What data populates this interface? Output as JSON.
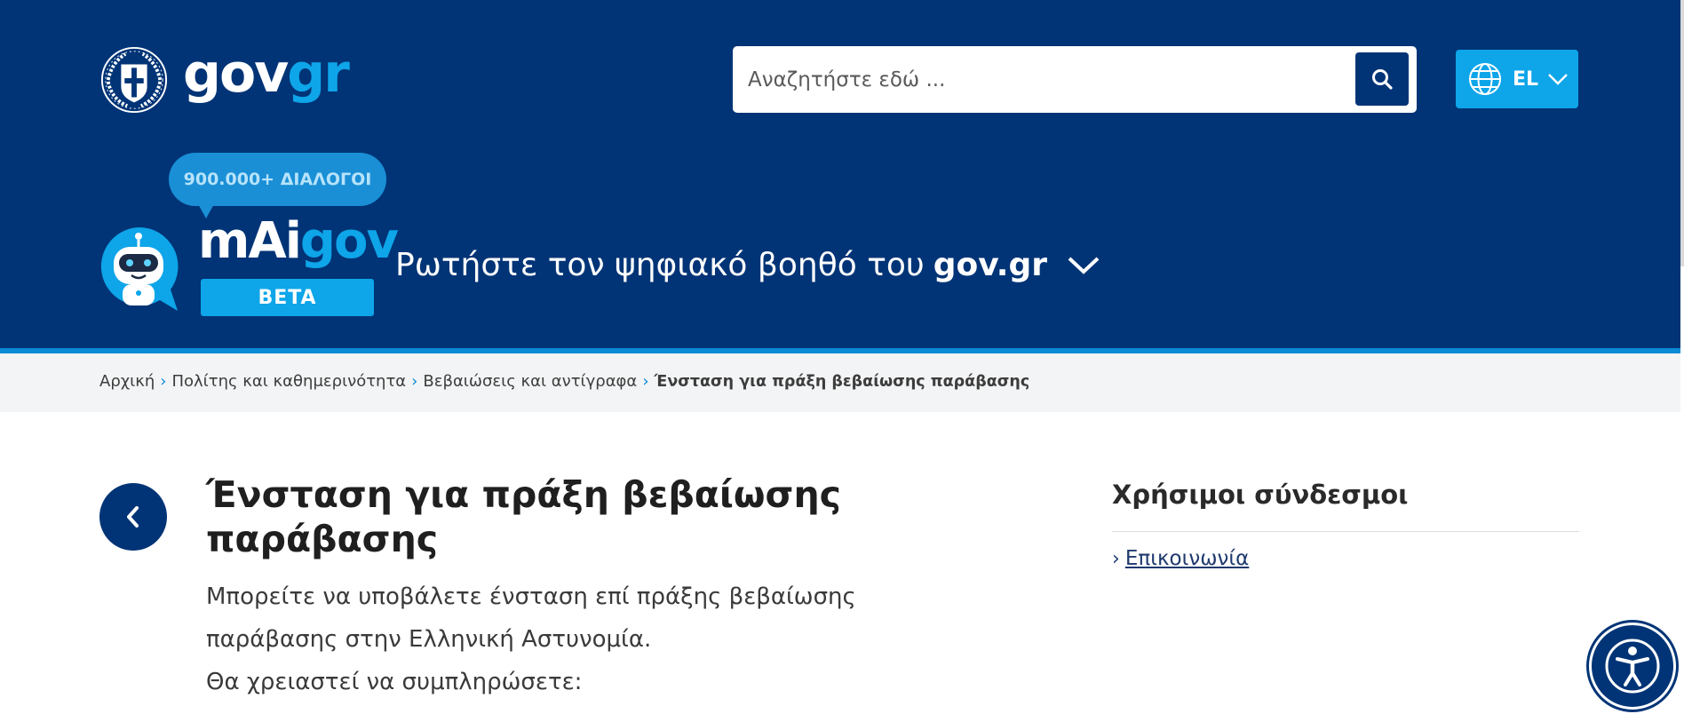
{
  "header": {
    "logo": {
      "part1": "gov",
      "part2": "gr"
    },
    "search": {
      "placeholder": "Αναζητήστε εδώ ..."
    },
    "language": {
      "label": "EL"
    }
  },
  "maigov": {
    "badge": "900.000+ ΔΙΑΛΟΓΟΙ",
    "title_part1": "mAi",
    "title_part2": "gov",
    "beta": "BETA",
    "assistant_text": "Ρωτήστε τον ψηφιακό βοηθό του",
    "assistant_bold": "gov.gr"
  },
  "breadcrumb": {
    "items": [
      "Αρχική",
      "Πολίτης και καθημερινότητα",
      "Βεβαιώσεις και αντίγραφα"
    ],
    "current": "Ένσταση για πράξη βεβαίωσης παράβασης"
  },
  "main": {
    "title": "Ένσταση για πράξη βεβαίωσης παράβασης",
    "description": "Μπορείτε να υποβάλετε ένσταση επί πράξης βεβαίωσης παράβασης στην Ελληνική Αστυνομία.",
    "fill_in": "Θα χρειαστεί να συμπληρώσετε:"
  },
  "sidebar": {
    "title": "Χρήσιμοι σύνδεσμοι",
    "links": [
      "Επικοινωνία"
    ]
  },
  "colors": {
    "header_bg": "#003476",
    "accent": "#0ea5e9",
    "stripe": "#0a8bd6",
    "breadcrumb_bg": "#f3f4f5"
  },
  "icons": [
    "national-emblem-icon",
    "search-icon",
    "globe-icon",
    "chevron-down-icon",
    "robot-icon",
    "chevron-left-icon",
    "accessibility-icon"
  ]
}
